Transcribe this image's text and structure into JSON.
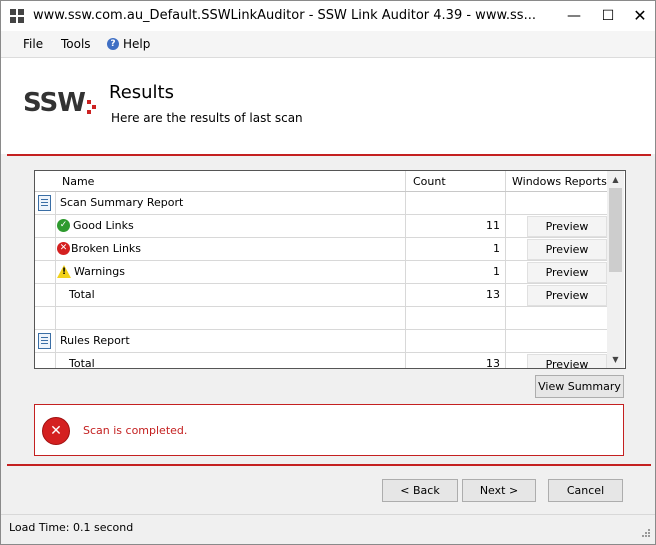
{
  "window": {
    "title": "www.ssw.com.au_Default.SSWLinkAuditor - SSW Link Auditor 4.39  - www.ss...",
    "minimize": "—",
    "maximize": "☐",
    "close": "✕"
  },
  "menu": {
    "file": "File",
    "tools": "Tools",
    "help": "Help",
    "help_icon": "?"
  },
  "header": {
    "logo": "SSW",
    "title": "Results",
    "subtitle": "Here are the results of last scan"
  },
  "grid": {
    "columns": {
      "name": "Name",
      "count": "Count",
      "reports": "Windows Reports"
    },
    "rows": [
      {
        "type": "group",
        "name": "Scan Summary Report",
        "count": "",
        "preview": ""
      },
      {
        "type": "item",
        "status": "good",
        "name": "Good Links",
        "count": "11",
        "preview": "Preview"
      },
      {
        "type": "item",
        "status": "broken",
        "name": "Broken Links",
        "count": "1",
        "preview": "Preview"
      },
      {
        "type": "item",
        "status": "warning",
        "name": "Warnings",
        "count": "1",
        "preview": "Preview"
      },
      {
        "type": "total",
        "name": "Total",
        "count": "13",
        "preview": "Preview"
      },
      {
        "type": "blank",
        "name": "",
        "count": "",
        "preview": ""
      },
      {
        "type": "group",
        "name": "Rules Report",
        "count": "",
        "preview": ""
      },
      {
        "type": "total",
        "name": "Total",
        "count": "13",
        "preview": "Preview"
      }
    ],
    "scroll_up": "▲",
    "scroll_down": "▼"
  },
  "buttons": {
    "view_summary": "View Summary",
    "back": "< Back",
    "next": "Next >",
    "cancel": "Cancel"
  },
  "status": {
    "message": "Scan is completed.",
    "icon": "✕"
  },
  "statusbar": {
    "load_time": "Load Time: 0.1 second"
  },
  "colors": {
    "accent_red": "#c42020",
    "good_green": "#2e9a2e",
    "warning_yellow": "#f2d21a"
  }
}
